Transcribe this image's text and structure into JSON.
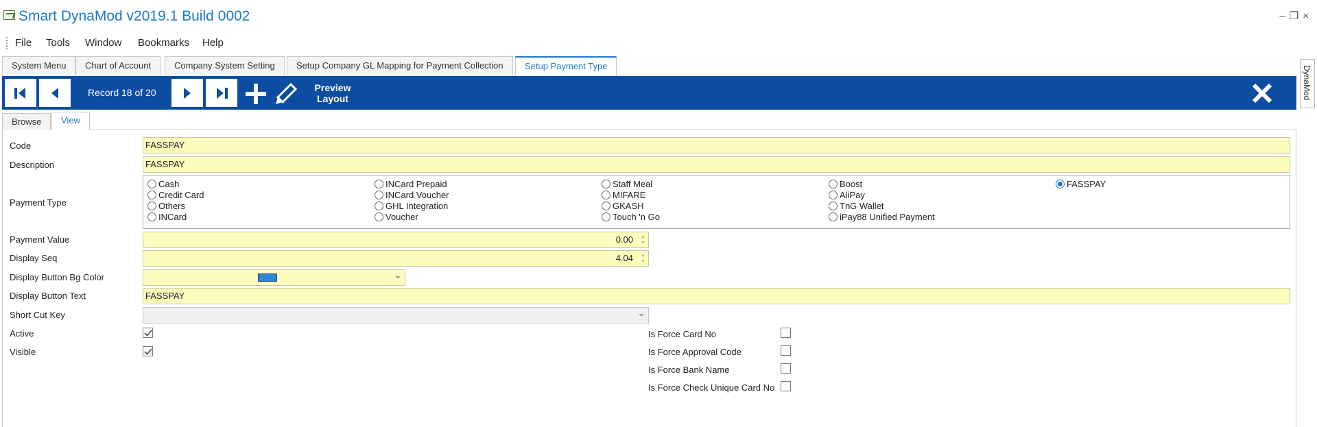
{
  "app": {
    "title": "Smart DynaMod v2019.1 Build 0002"
  },
  "menu": {
    "items": [
      "File",
      "Tools",
      "Window",
      "Bookmarks",
      "Help"
    ]
  },
  "doc_tabs": [
    {
      "label": "System Menu"
    },
    {
      "label": "Chart of Account"
    },
    {
      "label": "Company System Setting"
    },
    {
      "label": "Setup Company GL Mapping for Payment Collection"
    },
    {
      "label": "Setup Payment Type",
      "active": true
    }
  ],
  "side_tab": {
    "label": "DynaMod"
  },
  "toolbar": {
    "record_label": "Record 18 of 20",
    "preview_label": "Preview Layout",
    "icons": [
      "first-record-icon",
      "previous-record-icon",
      "next-record-icon",
      "last-record-icon",
      "add-icon",
      "edit-icon",
      "close-icon"
    ],
    "background": "#0d4da1"
  },
  "sub_tabs": [
    {
      "label": "Browse"
    },
    {
      "label": "View",
      "active": true
    }
  ],
  "form": {
    "code": {
      "label": "Code",
      "value": "FASSPAY"
    },
    "description": {
      "label": "Description",
      "value": "FASSPAY"
    },
    "payment_type": {
      "label": "Payment Type",
      "options": [
        [
          "Cash",
          "Credit Card",
          "Others",
          "INCard"
        ],
        [
          "INCard Prepaid",
          "INCard Voucher",
          "GHL Integration",
          "Voucher"
        ],
        [
          "Staff Meal",
          "MIFARE",
          "GKASH",
          "Touch 'n Go"
        ],
        [
          "Boost",
          "AliPay",
          "TnG Wallet",
          "iPay88 Unified Payment"
        ],
        [
          "FASSPAY"
        ]
      ],
      "selected": "FASSPAY"
    },
    "payment_value": {
      "label": "Payment Value",
      "value": "0.00"
    },
    "display_seq": {
      "label": "Display Seq",
      "value": "4.04"
    },
    "bg_color": {
      "label": "Display Button Bg Color",
      "color": "#2e86d6"
    },
    "button_text": {
      "label": "Display Button Text",
      "value": "FASSPAY"
    },
    "shortcut_key": {
      "label": "Short Cut Key",
      "value": ""
    },
    "active": {
      "label": "Active",
      "checked": true
    },
    "visible": {
      "label": "Visible",
      "checked": true
    },
    "force_card_no": {
      "label": "Is Force Card No",
      "checked": false
    },
    "force_approval_code": {
      "label": "Is Force Approval Code",
      "checked": false
    },
    "force_bank_name": {
      "label": "Is Force Bank Name",
      "checked": false
    },
    "force_unique_card": {
      "label": "Is Force Check Unique Card No",
      "checked": false
    }
  },
  "colors": {
    "accent": "#1e78c8",
    "field_bg": "#fdfcbd"
  }
}
